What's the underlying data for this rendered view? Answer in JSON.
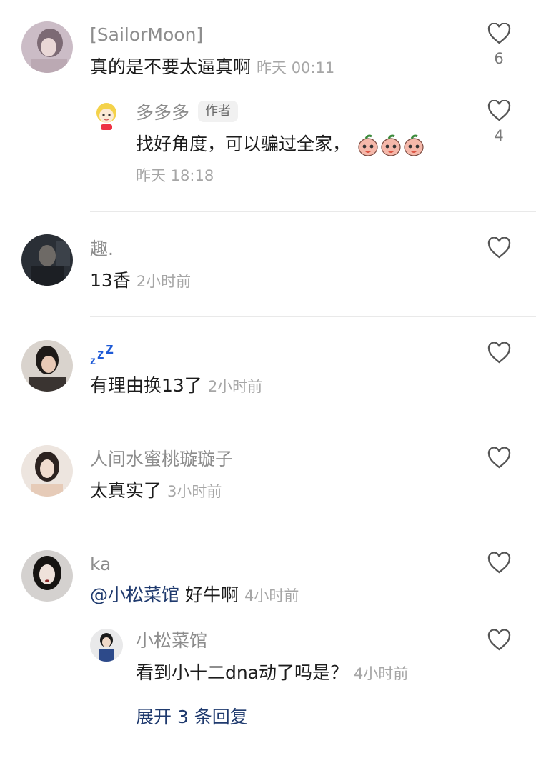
{
  "comments": [
    {
      "username": "[SailorMoon]",
      "text": "真的是不要太逼真啊",
      "time": "昨天 00:11",
      "likes": "6",
      "reply": {
        "username": "多多多",
        "tag": "作者",
        "text": "找好角度，可以骗过全家，",
        "time": "昨天 18:18",
        "likes": "4",
        "emoji_name": "peach-face-emoji"
      }
    },
    {
      "username": "趣.",
      "text": "13香",
      "time": "2小时前"
    },
    {
      "username": "zzz-icon",
      "text": "有理由换13了",
      "time": "2小时前"
    },
    {
      "username": "人间水蜜桃璇璇子",
      "text": "太真实了",
      "time": "3小时前"
    },
    {
      "username": "ka",
      "mention": "@小松菜馆",
      "text": "好牛啊",
      "time": "4小时前",
      "reply": {
        "username": "小松菜馆",
        "text": "看到小十二dna动了吗是？",
        "time": "4小时前"
      },
      "expand_label": "展开 3 条回复"
    }
  ],
  "colors": {
    "name": "#8d8d8d",
    "text": "#1c1c1c",
    "meta": "#a6a6a6",
    "link": "#1f3a6e",
    "zzz": "#1e5ad6"
  }
}
